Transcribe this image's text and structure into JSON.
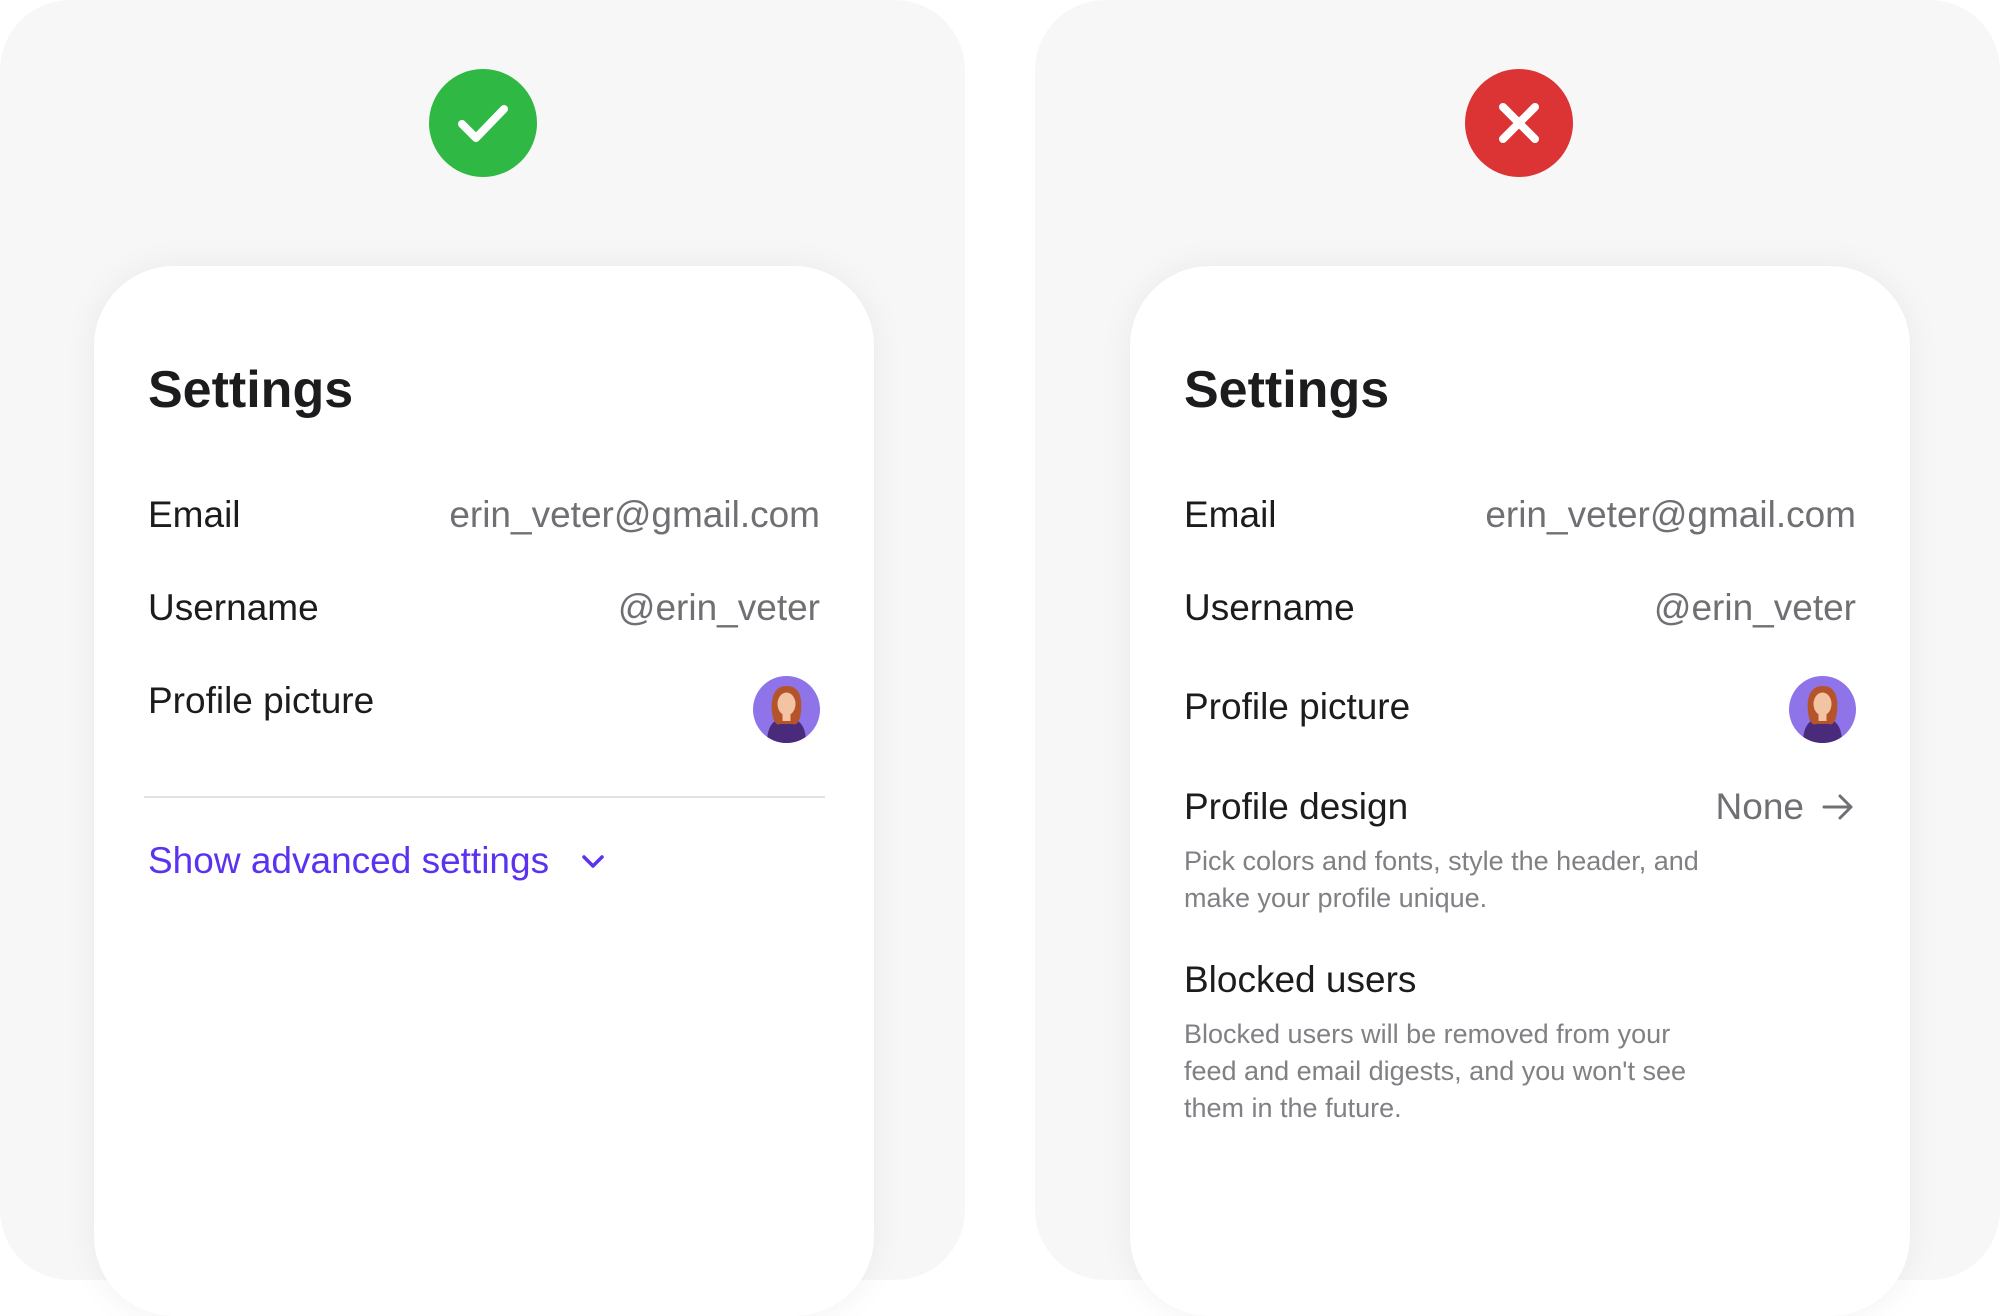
{
  "good": {
    "badge_icon": "check-icon",
    "badge_color": "#2fb843",
    "title": "Settings",
    "email_label": "Email",
    "email_value": "erin_veter@gmail.com",
    "username_label": "Username",
    "username_value": "@erin_veter",
    "picture_label": "Profile picture",
    "advanced_label": "Show advanced settings",
    "advanced_icon": "chevron-down-icon"
  },
  "bad": {
    "badge_icon": "close-icon",
    "badge_color": "#dc3434",
    "title": "Settings",
    "email_label": "Email",
    "email_value": "erin_veter@gmail.com",
    "username_label": "Username",
    "username_value": "@erin_veter",
    "picture_label": "Profile picture",
    "design_label": "Profile design",
    "design_value": "None",
    "design_icon": "arrow-right-icon",
    "design_desc": "Pick colors and fonts, style the header, and make your profile unique.",
    "blocked_label": "Blocked users",
    "blocked_desc": "Blocked users will be removed from your feed and email digests, and you won't see them in the future."
  },
  "colors": {
    "accent": "#5b32f0",
    "panel_bg": "#f7f7f7",
    "avatar_bg": "#8e74e8"
  }
}
